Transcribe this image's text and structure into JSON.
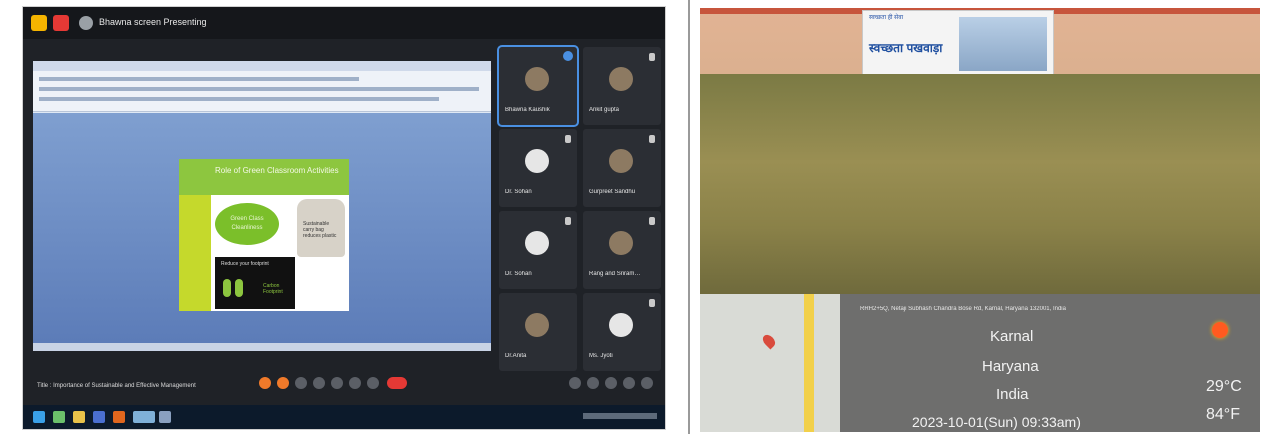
{
  "meeting": {
    "share_label": "Bhawna screen Presenting",
    "title": "Title : Importance of Sustainable and Effective Management",
    "participants": [
      {
        "name": "Bhawna Kaushik",
        "photo": true,
        "active": true
      },
      {
        "name": "Ankit gupta",
        "photo": true,
        "active": false
      },
      {
        "name": "Dr. Sohan",
        "photo": false,
        "active": false
      },
      {
        "name": "Gurpreet Sandhu",
        "photo": true,
        "active": false
      },
      {
        "name": "Dr. Sohan",
        "photo": false,
        "active": false
      },
      {
        "name": "Rang and Sriram…",
        "photo": true,
        "active": false
      },
      {
        "name": "Dr.Anita",
        "photo": false,
        "active": false
      },
      {
        "name": "Ms. Jyoti",
        "photo": false,
        "active": false
      }
    ]
  },
  "slide": {
    "title": "Role of Green Classroom Activities",
    "ellipse_text": "Green Class Cleanliness",
    "bag_text": "Sustainable carry bag reduces plastic",
    "feet_label": "Reduce your footprint",
    "feet_text": "Carbon Footprint"
  },
  "photo": {
    "banner_head": "स्वच्छता ही सेवा",
    "banner_main": "स्वच्छता पखवाड़ा",
    "address": "RRH2+5Q, Netaji Subhash Chandra Bose Rd, Karnal, Haryana 132001, India",
    "city": "Karnal",
    "state": "Haryana",
    "country": "India",
    "datetime": "2023-10-01(Sun)   09:33am)",
    "temp_c": "29°C",
    "temp_f": "84°F"
  }
}
